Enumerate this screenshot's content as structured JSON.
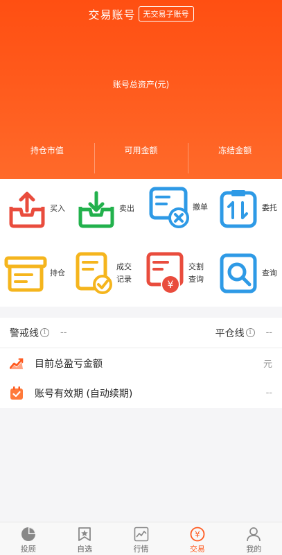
{
  "header": {
    "title": "交易账号",
    "badge": "无交易子账号",
    "total_assets_label": "账号总资产(元)",
    "stats": [
      "持仓市值",
      "可用金额",
      "冻结金额"
    ]
  },
  "grid": {
    "items": [
      {
        "label": "买入",
        "icon": "tray-upload-icon"
      },
      {
        "label": "卖出",
        "icon": "tray-download-icon"
      },
      {
        "label": "撤单",
        "icon": "cancel-order-icon"
      },
      {
        "label": "委托",
        "icon": "clipboard-transfer-icon"
      },
      {
        "label": "持仓",
        "icon": "archive-box-icon"
      },
      {
        "label": "成交记录",
        "icon": "document-check-icon"
      },
      {
        "label": "交割查询",
        "icon": "document-yen-icon"
      },
      {
        "label": "查询",
        "icon": "search-doc-icon"
      }
    ]
  },
  "risk": {
    "warning_label": "警戒线",
    "warning_value": "--",
    "close_label": "平仓线",
    "close_value": "--"
  },
  "rows": [
    {
      "label": "目前总盈亏金额",
      "value": "元",
      "icon": "trend-chart-icon"
    },
    {
      "label": "账号有效期 (自动续期)",
      "value": "--",
      "icon": "calendar-check-icon"
    }
  ],
  "tabbar": {
    "items": [
      {
        "label": "投顾",
        "icon": "pie-icon"
      },
      {
        "label": "自选",
        "icon": "star-bookmark-icon"
      },
      {
        "label": "行情",
        "icon": "line-chart-icon"
      },
      {
        "label": "交易",
        "icon": "yen-circle-icon"
      },
      {
        "label": "我的",
        "icon": "user-icon"
      }
    ],
    "active": "交易"
  },
  "colors": {
    "brand": "#ff5a1f",
    "red": "#e94c3d",
    "green": "#22b14c",
    "blue": "#2e9ae6",
    "yellow": "#f5b51d"
  }
}
